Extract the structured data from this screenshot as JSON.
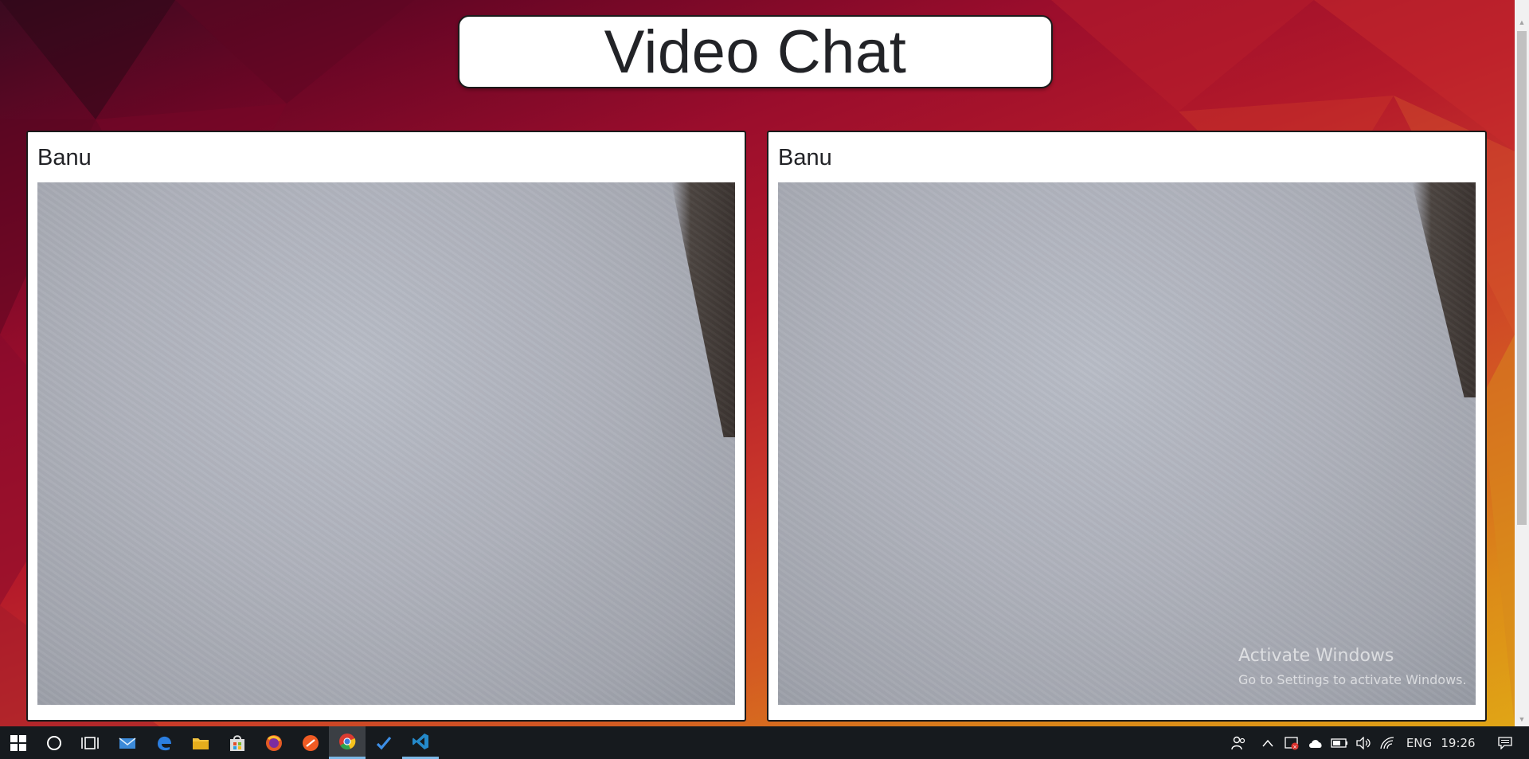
{
  "title": "Video Chat",
  "panels": [
    {
      "name": "Banu"
    },
    {
      "name": "Banu"
    }
  ],
  "watermark": {
    "line1": "Activate Windows",
    "line2": "Go to Settings to activate Windows."
  },
  "taskbar": {
    "apps": [
      "start-icon",
      "cortana-search-icon",
      "task-view-icon",
      "mail-icon",
      "edge-icon",
      "file-explorer-icon",
      "store-icon",
      "firefox-icon",
      "swift-icon",
      "chrome-icon",
      "todo-check-icon",
      "vscode-icon"
    ],
    "active_app": "chrome-icon",
    "language": "ENG",
    "time": "19:26"
  },
  "colors": {
    "background_start": "#3a0a20",
    "background_mid": "#b41a2a",
    "background_end": "#e0a516",
    "card": "#ffffff",
    "taskbar": "#161a1e"
  }
}
